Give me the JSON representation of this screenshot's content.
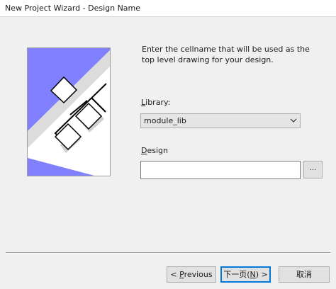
{
  "window": {
    "title": "New Project Wizard - Design Name"
  },
  "illustration": {
    "icon": "schematic-blocks-illustration",
    "colors": {
      "accent": "#8080ff",
      "shadow": "#dcdcdc",
      "line": "#000000"
    }
  },
  "description": "Enter the cellname that will be used as the top level drawing for your design.",
  "library": {
    "label_accel": "L",
    "label_rest": "ibrary:",
    "value": "module_lib"
  },
  "design": {
    "label_accel": "D",
    "label_rest": "esign",
    "value": "",
    "browse_label": "..."
  },
  "buttons": {
    "previous_prefix": "< ",
    "previous_accel": "P",
    "previous_rest": "revious",
    "next_prefix": "下一页(",
    "next_accel": "N",
    "next_suffix": ") >",
    "cancel": "取消"
  }
}
